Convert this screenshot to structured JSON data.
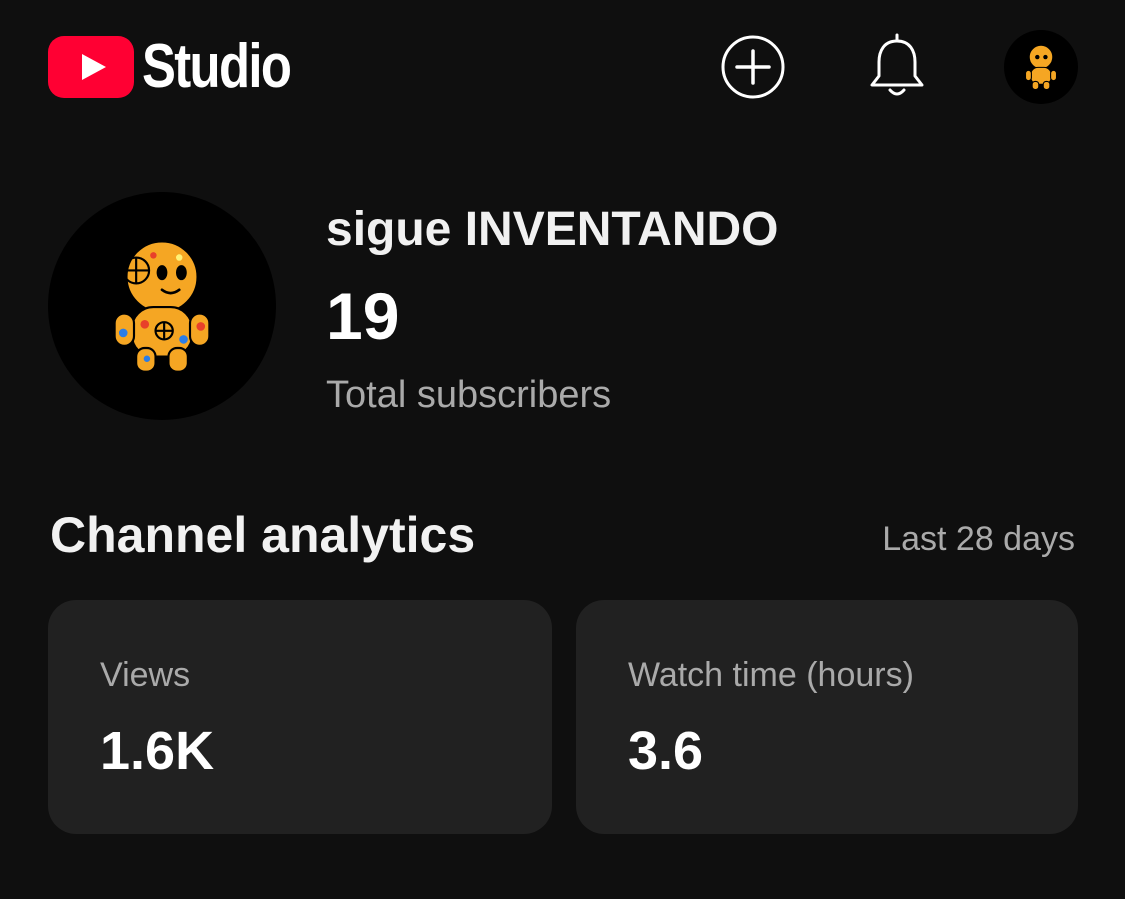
{
  "header": {
    "app_name": "Studio",
    "icons": [
      "youtube-play-icon",
      "create-plus-icon",
      "bell-icon",
      "avatar"
    ]
  },
  "channel": {
    "name": "sigue INVENTANDO",
    "subscriber_count": "19",
    "subscriber_label": "Total subscribers"
  },
  "analytics": {
    "title": "Channel analytics",
    "range": "Last 28 days",
    "cards": [
      {
        "label": "Views",
        "value": "1.6K"
      },
      {
        "label": "Watch time (hours)",
        "value": "3.6"
      }
    ]
  },
  "colors": {
    "background": "#0f0f0f",
    "card": "#212121",
    "brand_red": "#ff0033",
    "secondary_text": "#aaaaaa"
  }
}
